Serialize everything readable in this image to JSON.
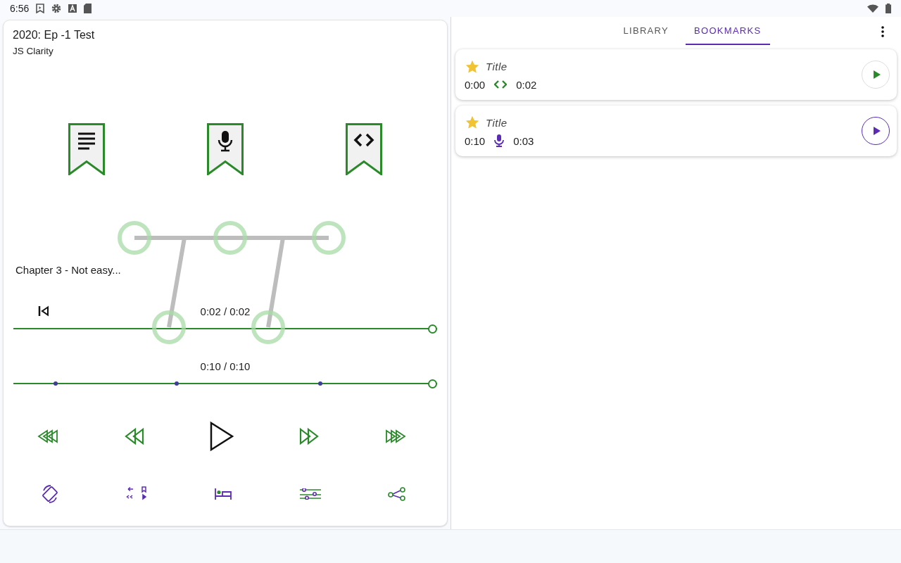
{
  "status_bar": {
    "time": "6:56"
  },
  "player": {
    "title": "2020: Ep -1 Test",
    "author": "JS Clarity",
    "bookmark_types": [
      {
        "kind": "text"
      },
      {
        "kind": "mic"
      },
      {
        "kind": "code"
      }
    ],
    "chapter": "Chapter 3 - Not easy...",
    "chapter_time": "0:02 / 0:02",
    "chapter_progress": {
      "level": 1
    },
    "total_time": "0:10 / 0:10",
    "total_progress": {
      "level": 1
    }
  },
  "tabs": [
    {
      "label": "LIBRARY",
      "selected": false
    },
    {
      "label": "BOOKMARKS",
      "selected": true
    }
  ],
  "bookmarks": [
    {
      "title": "Title",
      "start": "0:00",
      "end": "0:02",
      "kind": "code",
      "selected": false
    },
    {
      "title": "Title",
      "start": "0:10",
      "end": "0:03",
      "kind": "mic",
      "selected": true
    }
  ]
}
